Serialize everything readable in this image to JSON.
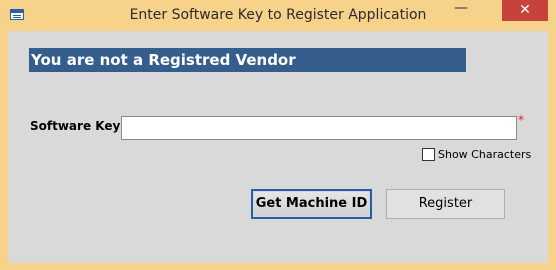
{
  "window": {
    "title": "Enter Software Key to Register Application",
    "minimize_glyph": "—",
    "close_glyph": "✕",
    "colors": {
      "frame": "#f6d28a",
      "client": "#d9d9d9",
      "close": "#c7423a",
      "banner": "#365e8d",
      "required": "#e02020"
    }
  },
  "form": {
    "banner": "You are not a Registred Vendor",
    "key_label": "Software Key:",
    "key_value": "",
    "required_mark": "*",
    "show_characters_label": "Show Characters",
    "show_characters_checked": false
  },
  "buttons": {
    "machine_id": "Get Machine ID",
    "register": "Register"
  }
}
